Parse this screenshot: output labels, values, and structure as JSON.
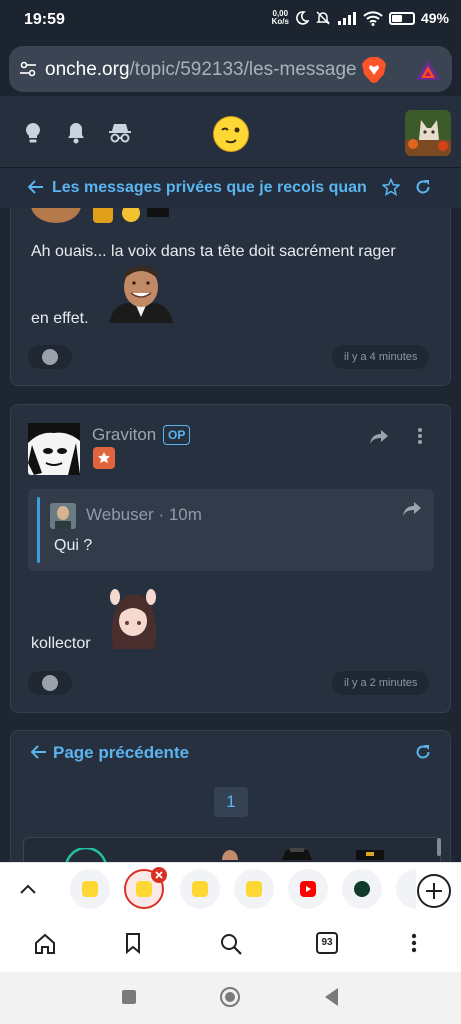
{
  "status": {
    "time": "19:59",
    "net_speed_value": "0,00",
    "net_speed_unit": "Ko/s",
    "battery_pct": "49%",
    "battery_level": 0.49
  },
  "browser": {
    "url_domain": "onche.org",
    "url_path": "/topic/592133/les-message"
  },
  "topic": {
    "title": "Les messages privées que je recois quan"
  },
  "posts": [
    {
      "text_line1": "Ah ouais... la voix dans ta tête doit sacrément rager",
      "text_line2": "en effet.",
      "time": "il y a 4 minutes"
    },
    {
      "username": "Graviton",
      "op_badge": "OP",
      "quote": {
        "user": "Webuser",
        "age": "· 10m",
        "text": "Qui ?"
      },
      "text": "kollector",
      "time": "il y a 2 minutes"
    }
  ],
  "pagination": {
    "prev_label": "Page précédente",
    "current_page": "1"
  },
  "tabs": {
    "count": "93"
  },
  "colors": {
    "accent": "#5ab4f0",
    "background": "#1e2632",
    "card": "#27303e",
    "youtube_red": "#ff0000"
  }
}
